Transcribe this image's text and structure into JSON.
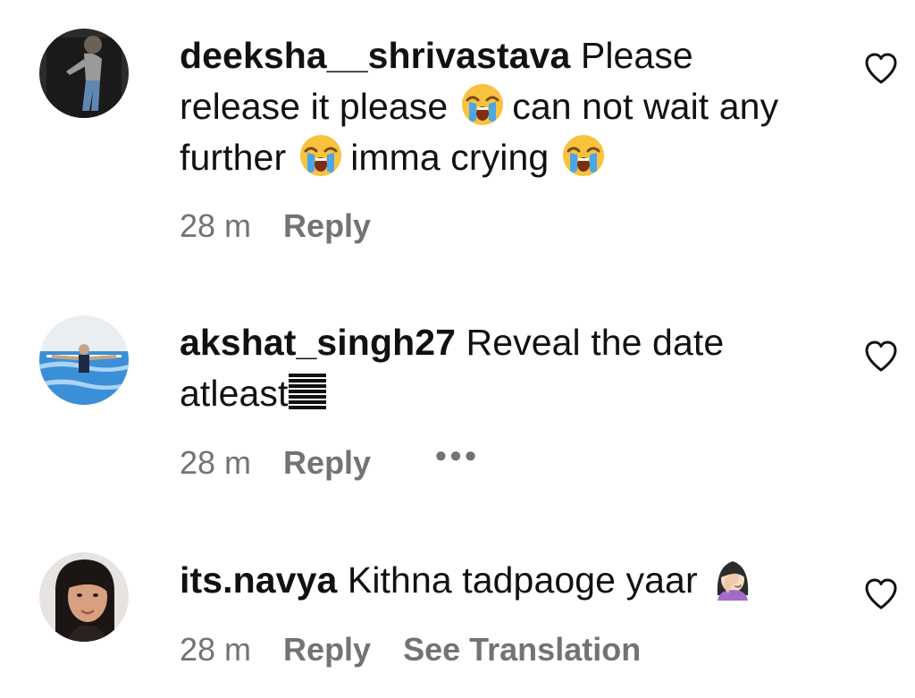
{
  "comments": [
    {
      "username": "deeksha__shrivastava",
      "text_segments": [
        "Please release it please",
        "can not wait any further",
        "imma crying"
      ],
      "emoji_icon": "loudly-crying-face-icon",
      "time": "28 m",
      "reply_label": "Reply"
    },
    {
      "username": "akshat_singh27",
      "text": "Reveal the date atleast",
      "emoji_icon": "horizontal-bars-icon",
      "time": "28 m",
      "reply_label": "Reply",
      "more_label": "•••"
    },
    {
      "username": "its.navya",
      "text": "Kithna tadpaoge yaar",
      "emoji_icon": "woman-facepalming-icon",
      "time": "28 m",
      "reply_label": "Reply",
      "translate_label": "See Translation"
    }
  ],
  "colors": {
    "text": "#111111",
    "meta": "#737373",
    "background": "#ffffff"
  }
}
